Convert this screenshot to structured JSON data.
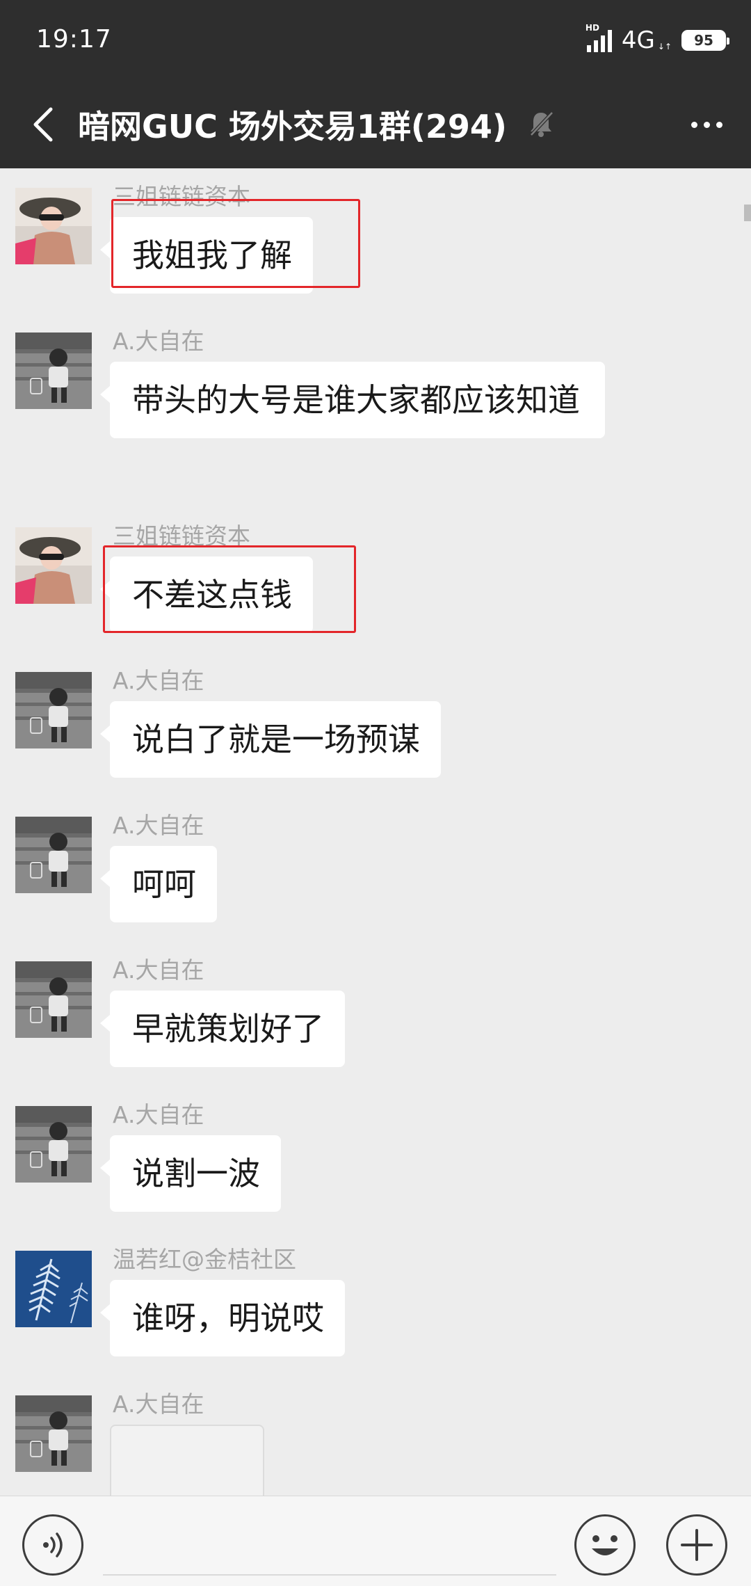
{
  "status_bar": {
    "time": "19:17",
    "signal_label": "HD",
    "network": "4G",
    "network_arrows": "↓↑",
    "battery": "95"
  },
  "header": {
    "title": "暗网GUC 场外交易1群(294)",
    "back_icon": "chevron-left-icon",
    "mute_icon": "bell-off-icon",
    "more_icon": "more-horizontal-icon"
  },
  "messages": [
    {
      "sender": "三姐链链资本",
      "text": "我姐我了解",
      "highlighted": true
    },
    {
      "sender": "A.大自在",
      "text": "带头的大号是谁大家都应该知道",
      "highlighted": false
    },
    {
      "sender": "三姐链链资本",
      "text": "不差这点钱",
      "highlighted": true
    },
    {
      "sender": "A.大自在",
      "text": "说白了就是一场预谋",
      "highlighted": false
    },
    {
      "sender": "A.大自在",
      "text": "呵呵",
      "highlighted": false
    },
    {
      "sender": "A.大自在",
      "text": "早就策划好了",
      "highlighted": false
    },
    {
      "sender": "A.大自在",
      "text": "说割一波",
      "highlighted": false
    },
    {
      "sender": "温若红@金桔社区",
      "text": "谁呀，明说哎",
      "highlighted": false
    },
    {
      "sender": "A.大自在",
      "text": "",
      "type": "image"
    }
  ],
  "input_bar": {
    "voice_icon": "voice-icon",
    "input_value": "",
    "emoji_icon": "smiley-icon",
    "plus_icon": "plus-icon"
  },
  "colors": {
    "header_bg": "#2e2e2e",
    "chat_bg": "#ededed",
    "bubble_bg": "#ffffff",
    "highlight_border": "#e3262a"
  }
}
